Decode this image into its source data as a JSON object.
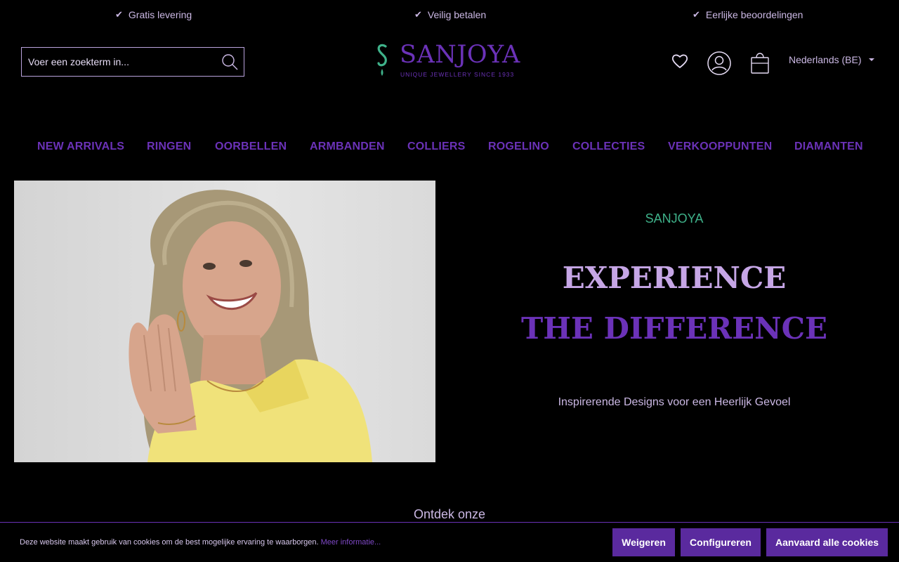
{
  "usp": [
    {
      "label": "Gratis levering"
    },
    {
      "label": "Veilig betalen"
    },
    {
      "label": "Eerlijke beoordelingen"
    }
  ],
  "search": {
    "placeholder": "Voer een zoekterm in...",
    "icon": "search-icon"
  },
  "logo": {
    "name": "SANJOYA",
    "tagline": "UNIQUE JEWELLERY SINCE 1933"
  },
  "header": {
    "language": "Nederlands (BE)",
    "icons": [
      "heart-icon",
      "account-icon",
      "shopping-bag-icon"
    ]
  },
  "nav": [
    "NEW ARRIVALS",
    "RINGEN",
    "OORBELLEN",
    "ARMBANDEN",
    "COLLIERS",
    "ROGELINO",
    "COLLECTIES",
    "VERKOOPPUNTEN",
    "DIAMANTEN"
  ],
  "hero": {
    "eyebrow": "SANJOYA",
    "headline_1": "EXPERIENCE",
    "headline_2": "THE DIFFERENCE",
    "subline": "Inspirerende Designs voor een Heerlijk Gevoel"
  },
  "discover": "Ontdek onze",
  "cookie": {
    "text": "Deze website maakt gebruik van cookies om de best mogelijke ervaring te waarborgen.",
    "more": "Meer informatie...",
    "refuse": "Weigeren",
    "configure": "Configureren",
    "accept": "Aanvaard alle cookies"
  },
  "colors": {
    "brand_purple": "#6b32b8",
    "accent_green": "#3fb28a",
    "lavender_text": "#cbb8e4",
    "background": "#000000"
  }
}
